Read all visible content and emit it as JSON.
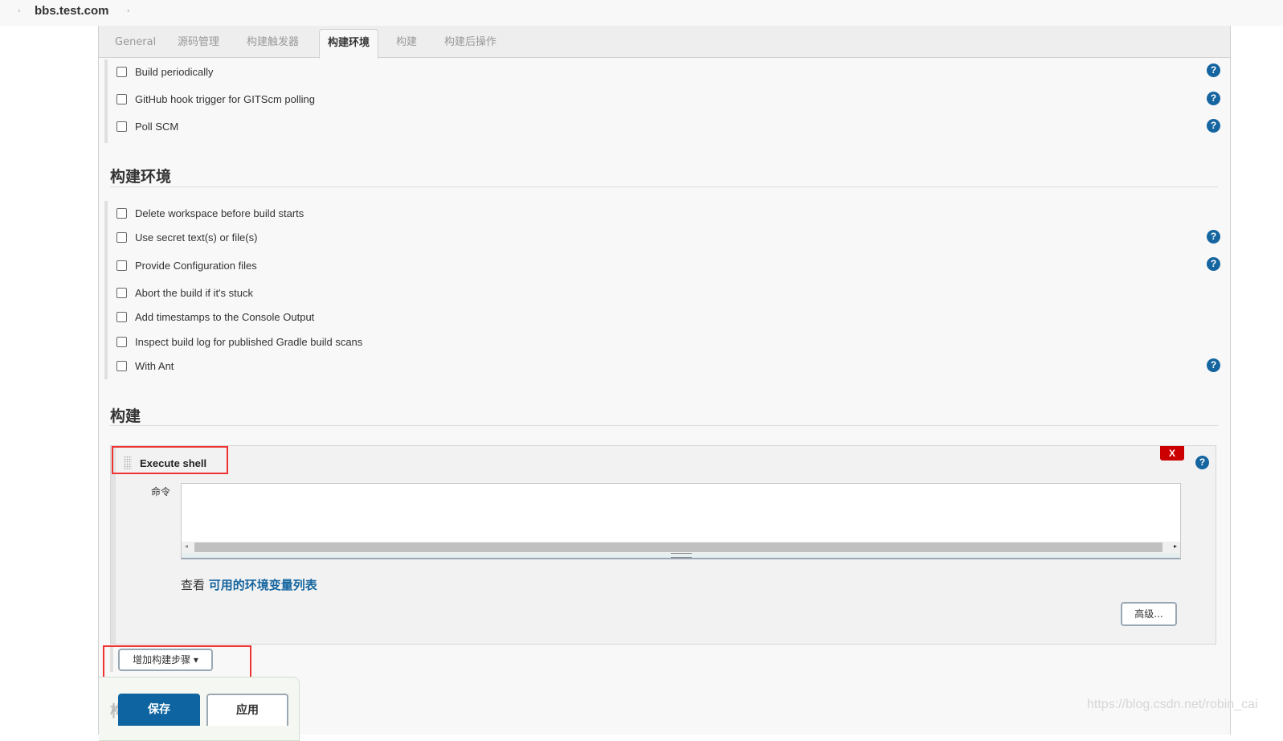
{
  "breadcrumb": {
    "title": "bbs.test.com"
  },
  "tabs": [
    {
      "label": "General",
      "active": false
    },
    {
      "label": "源码管理",
      "active": false
    },
    {
      "label": "构建触发器",
      "active": false
    },
    {
      "label": "构建环境",
      "active": true
    },
    {
      "label": "构建",
      "active": false
    },
    {
      "label": "构建后操作",
      "active": false
    }
  ],
  "triggers": {
    "items": [
      {
        "label": "Build periodically",
        "checked": false,
        "help": true
      },
      {
        "label": "GitHub hook trigger for GITScm polling",
        "checked": false,
        "help": true
      },
      {
        "label": "Poll SCM",
        "checked": false,
        "help": true
      }
    ]
  },
  "build_env": {
    "title": "构建环境",
    "items": [
      {
        "label": "Delete workspace before build starts",
        "checked": false,
        "help": false
      },
      {
        "label": "Use secret text(s) or file(s)",
        "checked": false,
        "help": true
      },
      {
        "label": "Provide Configuration files",
        "checked": false,
        "help": true
      },
      {
        "label": "Abort the build if it's stuck",
        "checked": false,
        "help": false
      },
      {
        "label": "Add timestamps to the Console Output",
        "checked": false,
        "help": false
      },
      {
        "label": "Inspect build log for published Gradle build scans",
        "checked": false,
        "help": false
      },
      {
        "label": "With Ant",
        "checked": false,
        "help": true
      }
    ]
  },
  "build": {
    "title": "构建",
    "step": {
      "title": "Execute shell",
      "delete_label": "X",
      "command_label": "命令",
      "command_value": "",
      "env_prefix": "查看",
      "env_link": "可用的环境变量列表",
      "advanced_label": "高级..."
    },
    "add_step_label": "增加构建步骤"
  },
  "footer": {
    "save_label": "保存",
    "apply_label": "应用",
    "ghost_text": "构"
  },
  "icons": {
    "help": "?",
    "dropdown": "▾",
    "arrow_left": "◂",
    "arrow_right": "▸",
    "crumb_sep": "›"
  },
  "colors": {
    "accent": "#1565a0",
    "danger": "#cc0000",
    "highlight": "#ee3333"
  },
  "watermark": "https://blog.csdn.net/robin_cai"
}
